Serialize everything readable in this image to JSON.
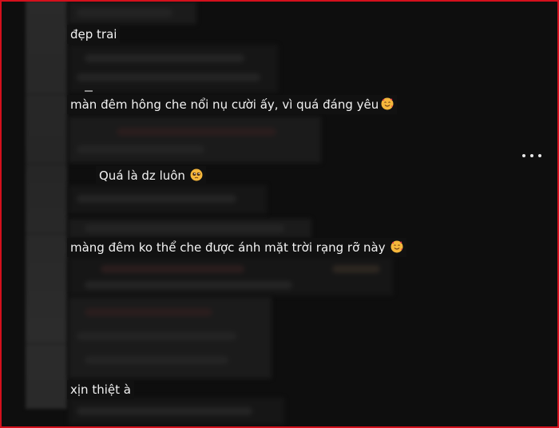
{
  "comments": [
    {
      "text": "đẹp trai",
      "emoji": ""
    },
    {
      "text": "màn đêm hông che nổi nụ cười ấy, vì quá đáng yêu",
      "emoji": "smiling-face-with-hearts-icon"
    },
    {
      "text": "Quá là dz luôn",
      "emoji": "pleading-face-icon"
    },
    {
      "text": "màng đêm ko thể che được ánh mặt trời rạng rỡ này",
      "emoji": "smiling-face-with-hearts-icon"
    },
    {
      "text": "xịn thiệt à",
      "emoji": ""
    }
  ],
  "more_menu": {
    "icon": "more-horizontal-icon"
  },
  "colors": {
    "frame": "#d4101c",
    "background": "#0e0e0e",
    "text": "#f2f2f2"
  }
}
